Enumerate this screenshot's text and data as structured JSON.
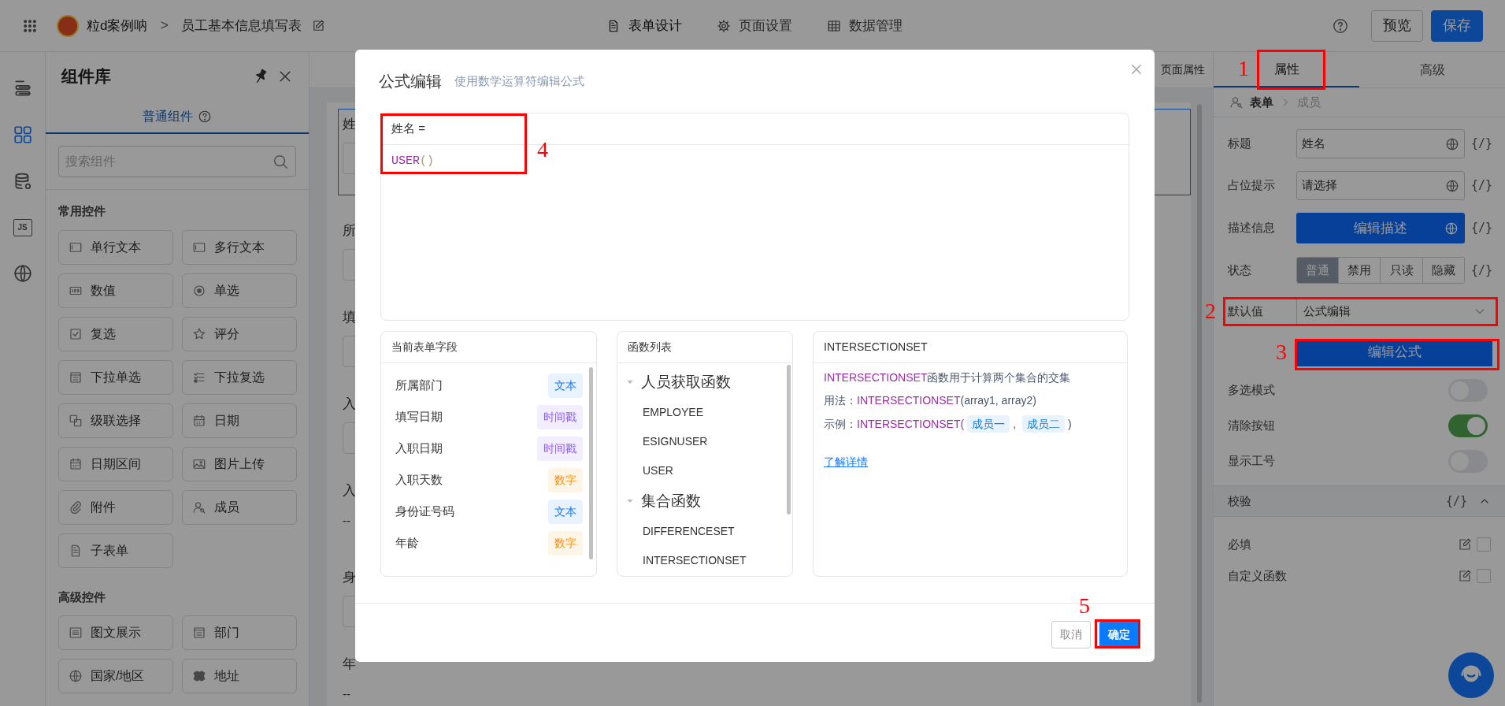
{
  "top_bar": {
    "app_name": "粒d案例呐",
    "separator": ">",
    "form_title": "员工基本信息填写表",
    "tabs": [
      {
        "label": "表单设计",
        "selected": true
      },
      {
        "label": "页面设置",
        "selected": false
      },
      {
        "label": "数据管理",
        "selected": false
      }
    ],
    "buttons": [
      {
        "label": "预览",
        "kind": "default"
      },
      {
        "label": "保存",
        "kind": "primary"
      }
    ]
  },
  "icon_rail": [
    {
      "selected": false
    },
    {
      "selected": true
    },
    {
      "selected": false
    },
    {
      "label": "JS",
      "selected": false
    },
    {
      "selected": false
    }
  ],
  "component_panel": {
    "title": "组件库",
    "tab": {
      "label": "普通组件",
      "selected": true
    },
    "search": {
      "placeholder": "搜索组件"
    },
    "sections": [
      {
        "title": "常用控件",
        "items": [
          {
            "label": "单行文本"
          },
          {
            "label": "多行文本"
          },
          {
            "label": "数值"
          },
          {
            "label": "单选"
          },
          {
            "label": "复选"
          },
          {
            "label": "评分"
          },
          {
            "label": "下拉单选"
          },
          {
            "label": "下拉复选"
          },
          {
            "label": "级联选择"
          },
          {
            "label": "日期"
          },
          {
            "label": "日期区间"
          },
          {
            "label": "图片上传"
          },
          {
            "label": "附件"
          },
          {
            "label": "成员"
          },
          {
            "label": "子表单"
          }
        ]
      },
      {
        "title": "高级控件",
        "items": [
          {
            "label": "图文展示"
          },
          {
            "label": "部门"
          },
          {
            "label": "国家/地区"
          },
          {
            "label": "地址"
          }
        ]
      }
    ]
  },
  "canvas": {
    "toolbar_label": "页面属性",
    "fields": [
      {
        "label": "姓",
        "kind": "input",
        "selected": true
      },
      {
        "label": "所",
        "kind": "input",
        "selected": false
      },
      {
        "label": "填",
        "kind": "input",
        "selected": false
      },
      {
        "label": "入",
        "kind": "input",
        "selected": false
      },
      {
        "label": "入",
        "kind": "text",
        "value": "--",
        "selected": false
      },
      {
        "label": "身",
        "kind": "input",
        "selected": false
      },
      {
        "label": "年",
        "kind": "text",
        "value": "--",
        "selected": false
      }
    ]
  },
  "properties_panel": {
    "tabs": [
      {
        "label": "属性",
        "selected": true
      },
      {
        "label": "高级",
        "selected": false
      }
    ],
    "breadcrumb": [
      {
        "label": "表单",
        "current": false
      },
      {
        "label": "成员",
        "current": true
      }
    ],
    "rows": [
      {
        "kind": "input",
        "label": "标题",
        "value": "姓名",
        "variable": "{/}"
      },
      {
        "kind": "input",
        "label": "占位提示",
        "value": "请选择",
        "variable": "{/}"
      },
      {
        "kind": "button",
        "label": "描述信息",
        "button": "编辑描述",
        "variable": "{/}"
      },
      {
        "kind": "segmented",
        "label": "状态",
        "options": [
          {
            "label": "普通",
            "selected": true
          },
          {
            "label": "禁用",
            "selected": false
          },
          {
            "label": "只读",
            "selected": false
          },
          {
            "label": "隐藏",
            "selected": false
          }
        ],
        "variable": "{/}"
      },
      {
        "kind": "select",
        "label": "默认值",
        "value": "公式编辑"
      },
      {
        "kind": "action",
        "button": "编辑公式"
      },
      {
        "kind": "toggle",
        "label": "多选模式",
        "on": false
      },
      {
        "kind": "toggle",
        "label": "清除按钮",
        "on": true
      },
      {
        "kind": "toggle",
        "label": "显示工号",
        "on": false
      }
    ],
    "validation": {
      "title": "校验",
      "variable": "{/}",
      "expanded": true,
      "rules": [
        {
          "label": "必填",
          "checked": false
        },
        {
          "label": "自定义函数",
          "checked": false
        }
      ]
    }
  },
  "formula_dialog": {
    "title": "公式编辑",
    "subtitle": "使用数学运算符编辑公式",
    "editor": {
      "target": "姓名 =",
      "function": "USER",
      "args": "()"
    },
    "fields_panel": {
      "title": "当前表单字段",
      "fields": [
        {
          "name": "所属部门",
          "type": "文本",
          "kind": "text"
        },
        {
          "name": "填写日期",
          "type": "时间戳",
          "kind": "timestamp"
        },
        {
          "name": "入职日期",
          "type": "时间戳",
          "kind": "timestamp"
        },
        {
          "name": "入职天数",
          "type": "数字",
          "kind": "number"
        },
        {
          "name": "身份证号码",
          "type": "文本",
          "kind": "text"
        },
        {
          "name": "年龄",
          "type": "数字",
          "kind": "number"
        }
      ]
    },
    "functions_panel": {
      "title": "函数列表",
      "groups": [
        {
          "name": "人员获取函数",
          "expanded": true,
          "children": [
            {
              "name": "EMPLOYEE"
            },
            {
              "name": "ESIGNUSER"
            },
            {
              "name": "USER"
            }
          ]
        },
        {
          "name": "集合函数",
          "expanded": true,
          "children": [
            {
              "name": "DIFFERENCESET"
            },
            {
              "name": "INTERSECTIONSET"
            }
          ]
        }
      ]
    },
    "detail": {
      "title": "INTERSECTIONSET",
      "description": {
        "function": "INTERSECTIONSET",
        "text": "函数用于计算两个集合的交集"
      },
      "usage": {
        "label": "用法：",
        "function": "INTERSECTIONSET",
        "args": "(array1, array2)"
      },
      "example": {
        "label": "示例：",
        "function": "INTERSECTIONSET",
        "open": "(",
        "tags": [
          "成员一",
          "成员二"
        ],
        "separator": ",",
        "close": ")"
      },
      "link": "了解详情"
    },
    "buttons": [
      {
        "label": "取消",
        "kind": "default"
      },
      {
        "label": "确定",
        "kind": "primary"
      }
    ]
  },
  "annotations": [
    {
      "label": "1"
    },
    {
      "label": "2"
    },
    {
      "label": "3"
    },
    {
      "label": "4"
    },
    {
      "label": "5"
    }
  ]
}
